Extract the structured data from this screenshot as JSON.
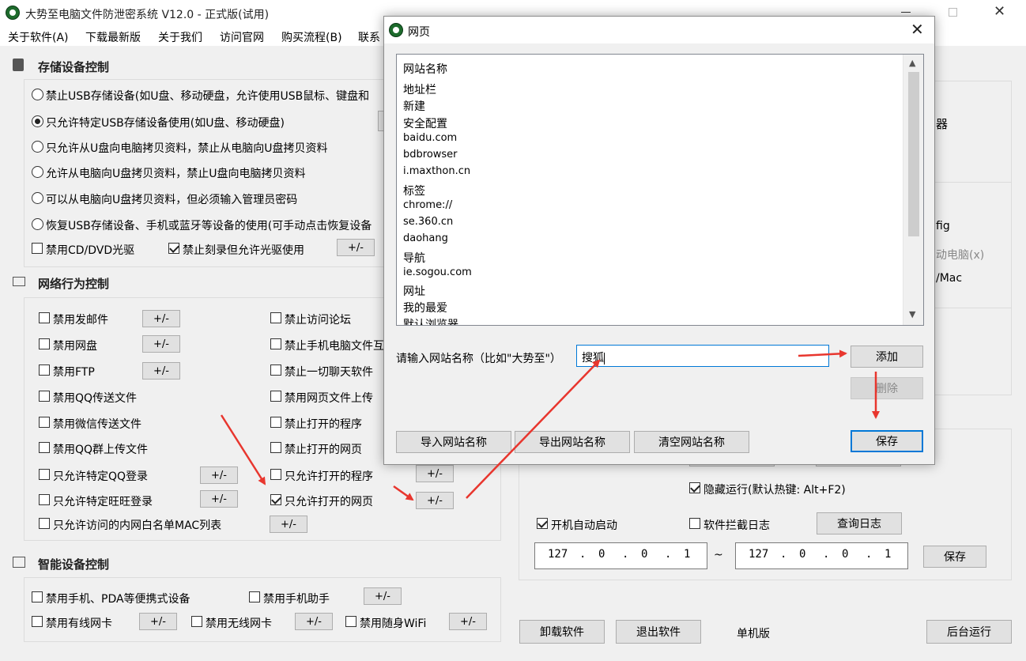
{
  "window": {
    "title": "大势至电脑文件防泄密系统 V12.0 - 正式版(试用)"
  },
  "menu": [
    "关于软件(A)",
    "下载最新版",
    "关于我们",
    "访问官网",
    "购买流程(B)",
    "联系"
  ],
  "storage": {
    "title": "存储设备控制",
    "options": [
      "禁止USB存储设备(如U盘、移动硬盘，允许使用USB鼠标、键盘和",
      "只允许特定USB存储设备使用(如U盘、移动硬盘)",
      "只允许从U盘向电脑拷贝资料，禁止从电脑向U盘拷贝资料",
      "允许从电脑向U盘拷贝资料，禁止U盘向电脑拷贝资料",
      "可以从电脑向U盘拷贝资料，但必须输入管理员密码",
      "恢复USB存储设备、手机或蓝牙等设备的使用(可手动点击恢复设备"
    ],
    "cd_label": "禁用CD/DVD光驱",
    "burn_label": "禁止刻录但允许光驱使用",
    "pm": "+/-"
  },
  "network": {
    "title": "网络行为控制",
    "left": [
      "禁用发邮件",
      "禁用网盘",
      "禁用FTP",
      "禁用QQ传送文件",
      "禁用微信传送文件",
      "禁用QQ群上传文件",
      "只允许特定QQ登录",
      "只允许特定旺旺登录",
      "只允许访问的内网白名单MAC列表"
    ],
    "right": [
      "禁止访问论坛",
      "禁止手机电脑文件互",
      "禁止一切聊天软件",
      "禁用网页文件上传",
      "禁止打开的程序",
      "禁止打开的网页",
      "只允许打开的程序",
      "只允许打开的网页"
    ]
  },
  "smart": {
    "title": "智能设备控制",
    "mobile": "禁用手机、PDA等便携式设备",
    "assistant": "禁用手机助手",
    "wired": "禁用有线网卡",
    "wireless": "禁用无线网卡",
    "wifi": "禁用随身WiFi"
  },
  "right": {
    "frag1": "器",
    "frag2": "fig",
    "frag3": "动电脑(x)",
    "frag4": "/Mac"
  },
  "settings": {
    "hide_run": "隐藏运行(默认热键: Alt+F2)",
    "autostart": "开机自动启动",
    "intercept_log": "软件拦截日志",
    "query_log": "查询日志",
    "ip_start": [
      "127",
      ".",
      "0",
      ".",
      "0",
      ".",
      "1"
    ],
    "ip_end": [
      "127",
      ".",
      "0",
      ".",
      "0",
      ".",
      "1"
    ],
    "tilde": "~",
    "save": "保存"
  },
  "bottom": {
    "uninstall": "卸载软件",
    "exit": "退出软件",
    "edition": "单机版",
    "background": "后台运行"
  },
  "dialog": {
    "title": "网页",
    "list": [
      "网站名称",
      "地址栏",
      "新建",
      "安全配置",
      "baidu.com",
      "bdbrowser",
      "i.maxthon.cn",
      "标签",
      "chrome://",
      "se.360.cn",
      "daohang",
      "导航",
      "ie.sogou.com",
      "网址",
      "我的最爱",
      "默认浏览器"
    ],
    "prompt": "请输入网站名称（比如\"大势至\"）",
    "input_value": "搜狐",
    "add": "添加",
    "delete": "删除",
    "import": "导入网站名称",
    "export": "导出网站名称",
    "clear": "清空网站名称",
    "save": "保存"
  },
  "colors": {
    "arrow": "#e8362e",
    "default_border": "#0078d7"
  }
}
